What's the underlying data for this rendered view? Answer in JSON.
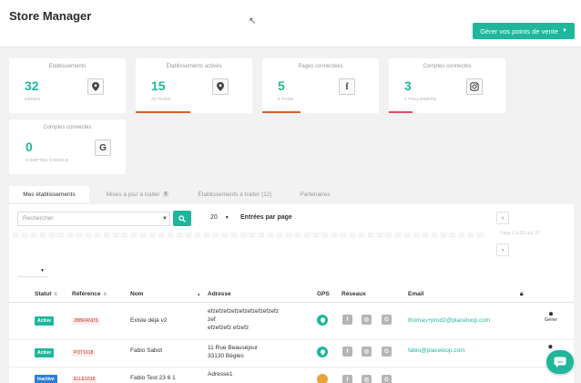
{
  "header": {
    "title": "Store Manager",
    "primary_button": "Gérer vos points de vente"
  },
  "colors": {
    "accent": "#1fb79c",
    "orange": "#d5612a",
    "pink": "#d94b66"
  },
  "stats": [
    {
      "title": "Etablissements",
      "value": "32",
      "sub": "GÉRÉS",
      "icon": "location-pin-icon"
    },
    {
      "title": "Établissements activés",
      "value": "15",
      "sub": "ACTIVÉS",
      "icon": "location-pin-icon"
    },
    {
      "title": "Pages connectées",
      "value": "5",
      "sub": "5 FANS",
      "icon": "facebook-icon"
    },
    {
      "title": "Comptes connectés",
      "value": "3",
      "sub": "1 FOLLOWERS",
      "icon": "instagram-icon"
    },
    {
      "title": "Comptes connectés",
      "value": "0",
      "sub": "COMPTES GOOGLE",
      "icon": "google-icon"
    }
  ],
  "tabs": [
    {
      "label": "Mes établissements",
      "active": true
    },
    {
      "label": "Mises à jour à traiter",
      "badge": "0"
    },
    {
      "label": "Établissements à traiter (12)"
    },
    {
      "label": "Partenaires"
    }
  ],
  "search": {
    "placeholder": "Rechercher"
  },
  "entries": {
    "value": "20",
    "label": "Entrées par page"
  },
  "pager": {
    "prev": "‹",
    "next": "›",
    "text": "Page 1 à 2/3 sur 32"
  },
  "table": {
    "columns": [
      "Statut",
      "Référence",
      "Nom",
      "Adresse",
      "GPS",
      "Réseaux",
      "Email"
    ],
    "rows": [
      {
        "status": "Active",
        "reference": "JBBRANDS",
        "name": "Existe déjà v2",
        "address": [
          "efzefzefzefzefzefzefzefzefz",
          "zef",
          "efzefzefz efzefz"
        ],
        "email": "thomas+prod2@placeloop.com",
        "manage": "Gérer"
      },
      {
        "status": "Active",
        "reference": "POT1618",
        "name": "Fabio Sabot",
        "address": [
          "11 Rue Beauséjour",
          "33130 Bègles"
        ],
        "email": "fabio@placeloop.com"
      },
      {
        "status": "Inactive",
        "reference": "ELLE1618",
        "name": "Fabio Test 23 6 1",
        "address": [
          "Adresse1"
        ]
      }
    ]
  }
}
